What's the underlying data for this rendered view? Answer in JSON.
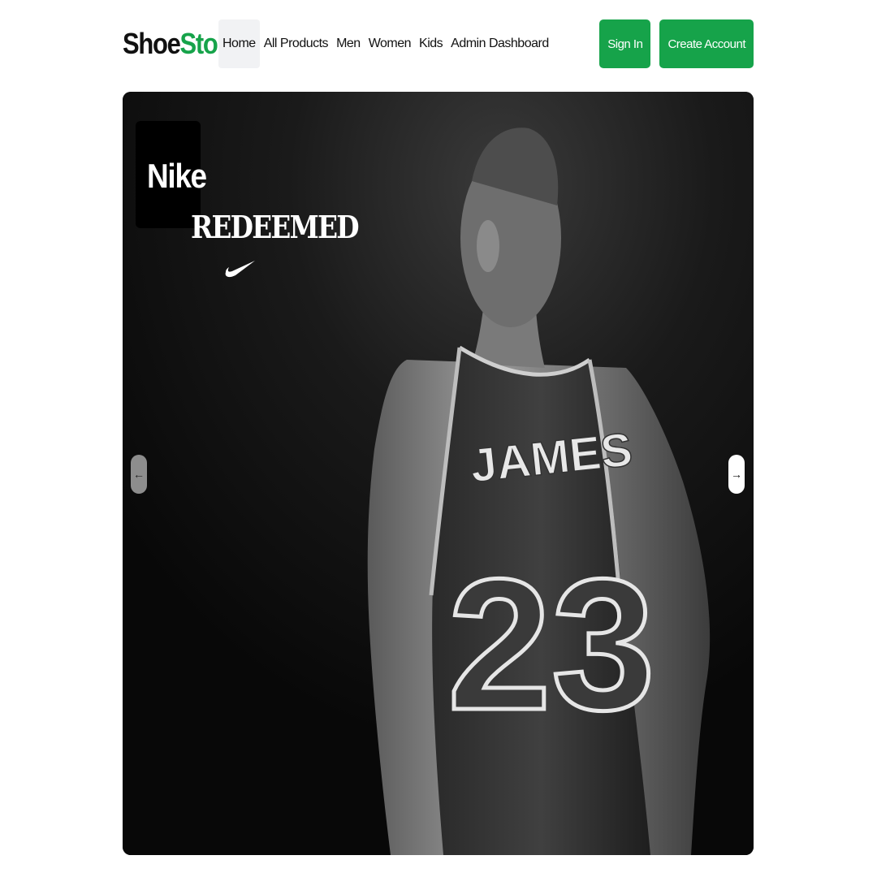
{
  "header": {
    "logo": {
      "part1": "Shoe",
      "part2": "Store"
    },
    "nav": [
      {
        "label": "Home",
        "active": true
      },
      {
        "label": "All Products"
      },
      {
        "label": "Men"
      },
      {
        "label": "Women"
      },
      {
        "label": "Kids"
      },
      {
        "label": "Admin Dashboard"
      }
    ],
    "sign_in_label": "Sign In",
    "create_account_label": "Create Account"
  },
  "hero": {
    "brand": "Nike",
    "headline": "REDEEMED",
    "jersey_name": "JAMES",
    "jersey_number": "23",
    "prev_icon": "arrow-left-icon",
    "next_icon": "arrow-right-icon"
  },
  "colors": {
    "accent": "#16a34a",
    "hero_bg": "#0c0c0c"
  }
}
